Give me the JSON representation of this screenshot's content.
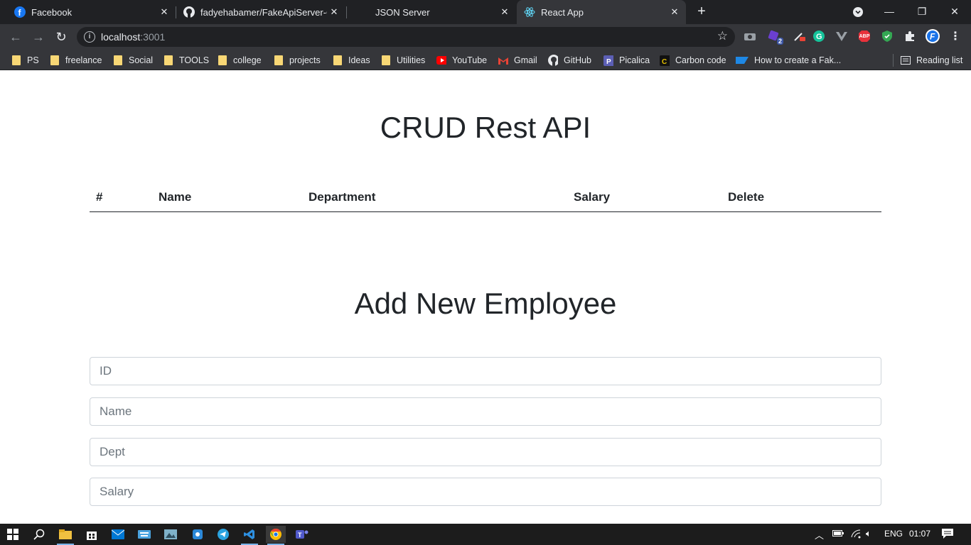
{
  "browser": {
    "tabs": [
      {
        "title": "Facebook",
        "icon": "facebook-icon"
      },
      {
        "title": "fadyehabamer/FakeApiServer-Cr",
        "icon": "github-icon"
      },
      {
        "title": "JSON Server",
        "icon": "none"
      },
      {
        "title": "React App",
        "icon": "react-icon"
      }
    ],
    "url_host": "localhost",
    "url_port": ":3001",
    "extension_badge": "2",
    "abp_label": "ABP",
    "bookmarks": [
      {
        "label": "PS",
        "icon": "folder-icon"
      },
      {
        "label": "freelance",
        "icon": "folder-icon"
      },
      {
        "label": "Social",
        "icon": "folder-icon"
      },
      {
        "label": "TOOLS",
        "icon": "folder-icon"
      },
      {
        "label": "college",
        "icon": "folder-icon"
      },
      {
        "label": "projects",
        "icon": "folder-icon"
      },
      {
        "label": "Ideas",
        "icon": "folder-icon"
      },
      {
        "label": "Utilities",
        "icon": "folder-icon"
      },
      {
        "label": "YouTube",
        "icon": "youtube-icon"
      },
      {
        "label": "Gmail",
        "icon": "gmail-icon"
      },
      {
        "label": "GitHub",
        "icon": "github-icon"
      },
      {
        "label": "Picalica",
        "icon": "picalica-icon"
      },
      {
        "label": "Carbon code",
        "icon": "carbon-icon"
      },
      {
        "label": "How to create a Fak...",
        "icon": "sap-icon"
      }
    ],
    "reading_list": "Reading list"
  },
  "page": {
    "title": "CRUD Rest API",
    "table_headers": [
      "#",
      "Name",
      "Department",
      "Salary",
      "Delete"
    ],
    "form_title": "Add New Employee",
    "fields": [
      {
        "placeholder": "ID"
      },
      {
        "placeholder": "Name"
      },
      {
        "placeholder": "Dept"
      },
      {
        "placeholder": "Salary"
      }
    ]
  },
  "taskbar": {
    "lang": "ENG",
    "time": "01:07"
  },
  "colors": {
    "tab_bar": "#202124",
    "toolbar": "#35363a",
    "text": "#212529",
    "field_border": "#ced4da",
    "taskbar": "#1c1c1c"
  }
}
